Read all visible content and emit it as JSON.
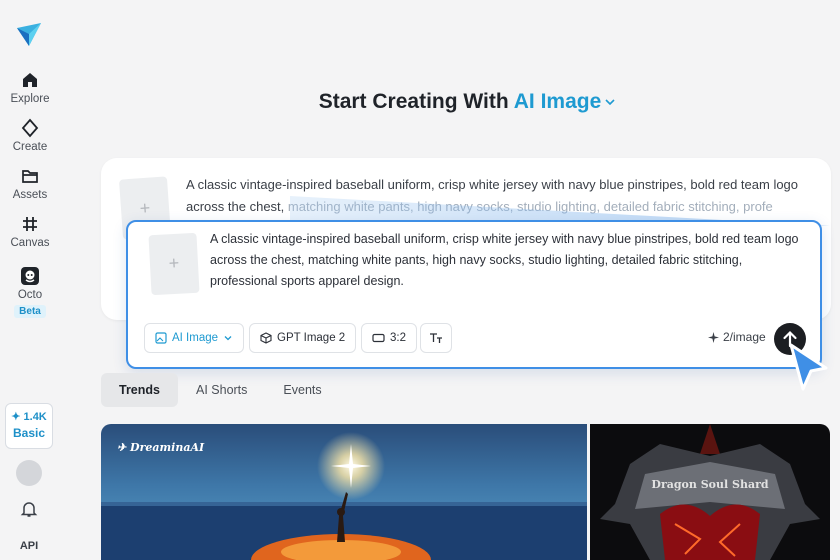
{
  "sidebar": {
    "items": [
      {
        "label": "Explore",
        "icon": "home-icon"
      },
      {
        "label": "Create",
        "icon": "diamond-icon"
      },
      {
        "label": "Assets",
        "icon": "folder-icon"
      },
      {
        "label": "Canvas",
        "icon": "grid-icon"
      },
      {
        "label": "Octo",
        "icon": "octo-icon",
        "badge": "Beta"
      }
    ],
    "credits": {
      "amount": "1.4K",
      "tier": "Basic"
    },
    "api_label": "API"
  },
  "header": {
    "title_prefix": "Start Creating With",
    "title_accent": "AI Image"
  },
  "prompt": {
    "bg_text_normal": "A classic vintage-inspired baseball uniform, crisp white jersey with navy blue pinstripes, bold red team logo across the chest, ",
    "bg_text_faded": "matching white pants, high navy socks,  studio lighting, detailed fabric stitching, profe",
    "text": "A classic vintage-inspired baseball uniform, crisp white jersey with navy blue pinstripes, bold red team logo across the chest, matching white pants, high navy socks,  studio lighting, detailed fabric stitching, professional sports apparel design.",
    "chips": {
      "mode": "AI Image",
      "model": "GPT Image 2",
      "ratio": "3:2"
    },
    "cost": "2/image"
  },
  "tabs": [
    "Trends",
    "AI Shorts",
    "Events"
  ],
  "gallery": {
    "left_watermark": "DreaminaAI",
    "right_title": "Dragon Soul Shard"
  },
  "colors": {
    "accent": "#1e9ad1",
    "focus_border": "#3f8fe6",
    "send_button": "#1c1e22"
  }
}
